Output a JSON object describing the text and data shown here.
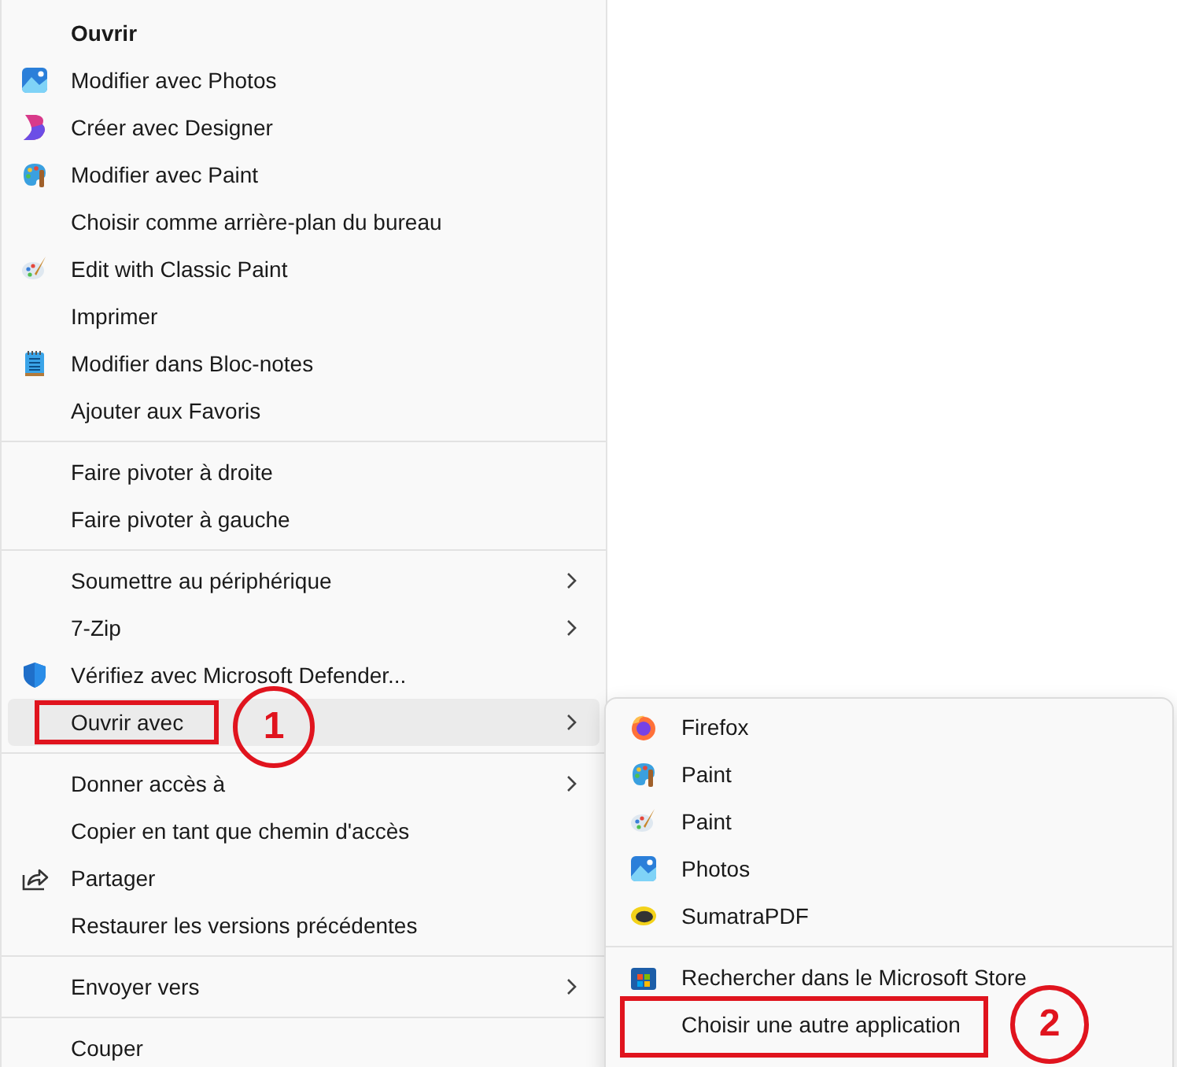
{
  "context_menu": {
    "groups": [
      [
        {
          "label": "Ouvrir",
          "bold": true,
          "has_submenu": false,
          "selected": false
        },
        {
          "label": "Modifier avec Photos",
          "bold": false,
          "has_submenu": false,
          "selected": false
        },
        {
          "label": "Créer avec Designer",
          "bold": false,
          "has_submenu": false,
          "selected": false
        },
        {
          "label": "Modifier avec Paint",
          "bold": false,
          "has_submenu": false,
          "selected": false
        },
        {
          "label": "Choisir comme arrière-plan du bureau",
          "bold": false,
          "has_submenu": false,
          "selected": false
        },
        {
          "label": "Edit with Classic Paint",
          "bold": false,
          "has_submenu": false,
          "selected": false
        },
        {
          "label": "Imprimer",
          "bold": false,
          "has_submenu": false,
          "selected": false
        },
        {
          "label": "Modifier dans Bloc-notes",
          "bold": false,
          "has_submenu": false,
          "selected": false
        },
        {
          "label": "Ajouter aux Favoris",
          "bold": false,
          "has_submenu": false,
          "selected": false
        }
      ],
      [
        {
          "label": "Faire pivoter à droite",
          "bold": false,
          "has_submenu": false,
          "selected": false
        },
        {
          "label": "Faire pivoter à gauche",
          "bold": false,
          "has_submenu": false,
          "selected": false
        }
      ],
      [
        {
          "label": "Soumettre au périphérique",
          "bold": false,
          "has_submenu": true,
          "selected": false
        },
        {
          "label": "7-Zip",
          "bold": false,
          "has_submenu": true,
          "selected": false
        },
        {
          "label": "Vérifiez avec Microsoft Defender...",
          "bold": false,
          "has_submenu": false,
          "selected": false
        },
        {
          "label": "Ouvrir avec",
          "bold": false,
          "has_submenu": true,
          "selected": true,
          "callout": "1"
        }
      ],
      [
        {
          "label": "Donner accès à",
          "bold": false,
          "has_submenu": true,
          "selected": false
        },
        {
          "label": "Copier en tant que chemin d'accès",
          "bold": false,
          "has_submenu": false,
          "selected": false
        },
        {
          "label": "Partager",
          "bold": false,
          "has_submenu": false,
          "selected": false
        },
        {
          "label": "Restaurer les versions précédentes",
          "bold": false,
          "has_submenu": false,
          "selected": false
        }
      ],
      [
        {
          "label": "Envoyer vers",
          "bold": false,
          "has_submenu": true,
          "selected": false
        }
      ],
      [
        {
          "label": "Couper",
          "bold": false,
          "has_submenu": false,
          "selected": false
        }
      ]
    ]
  },
  "open_with_submenu": {
    "groups": [
      [
        {
          "label": "Firefox",
          "selected": false
        },
        {
          "label": "Paint",
          "selected": false
        },
        {
          "label": "Paint",
          "selected": false
        },
        {
          "label": "Photos",
          "selected": false
        },
        {
          "label": "SumatraPDF",
          "selected": false
        }
      ],
      [
        {
          "label": "Rechercher dans le Microsoft Store",
          "selected": false
        },
        {
          "label": "Choisir une autre application",
          "selected": false,
          "callout": "2"
        }
      ]
    ]
  }
}
